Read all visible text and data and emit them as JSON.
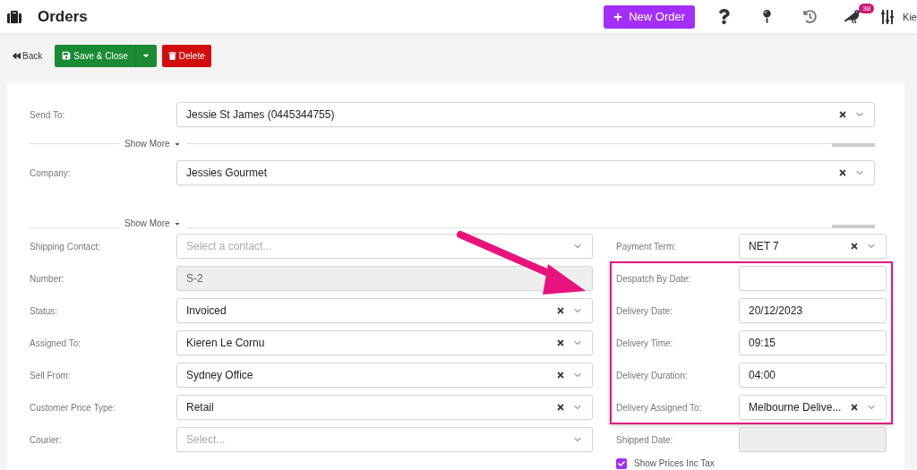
{
  "header": {
    "title": "Orders",
    "new_order_label": "New Order",
    "notification_count": "38",
    "user_name": "Kie"
  },
  "toolbar": {
    "back_label": "Back",
    "save_label": "Save & Close",
    "delete_label": "Delete"
  },
  "top_fields": [
    {
      "label": "Send To:",
      "value": "Jessie St James (0445344755)",
      "show_more": "Show More"
    },
    {
      "label": "Company:",
      "value": "Jessies Gourmet",
      "show_more": "Show More"
    }
  ],
  "left_fields": [
    {
      "kind": "select",
      "label": "Shipping Contact:",
      "placeholder": "Select a contact...",
      "clearable": false
    },
    {
      "kind": "readonly",
      "label": "Number:",
      "value": "S-2"
    },
    {
      "kind": "select",
      "label": "Status:",
      "value": "Invoiced",
      "clearable": true
    },
    {
      "kind": "select",
      "label": "Assigned To:",
      "value": "Kieren Le Cornu",
      "clearable": true
    },
    {
      "kind": "select",
      "label": "Sell From:",
      "value": "Sydney Office",
      "clearable": true
    },
    {
      "kind": "select",
      "label": "Customer Price Type:",
      "value": "Retail",
      "clearable": true
    },
    {
      "kind": "select",
      "label": "Courier:",
      "placeholder": "Select...",
      "clearable": false
    }
  ],
  "right_fields": [
    {
      "kind": "select",
      "label": "Payment Term:",
      "value": "NET 7",
      "clearable": true,
      "highlighted": false
    },
    {
      "kind": "text",
      "label": "Despatch By Date:",
      "highlighted": true
    },
    {
      "kind": "text",
      "label": "Delivery Date:",
      "value": "20/12/2023",
      "highlighted": true
    },
    {
      "kind": "text",
      "label": "Delivery Time:",
      "value": "09:15",
      "highlighted": true
    },
    {
      "kind": "text",
      "label": "Delivery Duration:",
      "value": "04:00",
      "highlighted": true
    },
    {
      "kind": "select",
      "label": "Delivery Assigned To:",
      "value": "Melbourne Delive...",
      "clearable": true,
      "highlighted": true
    },
    {
      "kind": "readonly",
      "label": "Shipped Date:",
      "highlighted": false
    }
  ],
  "tax_checkbox": {
    "label": "Show Prices Inc Tax",
    "checked": true
  }
}
